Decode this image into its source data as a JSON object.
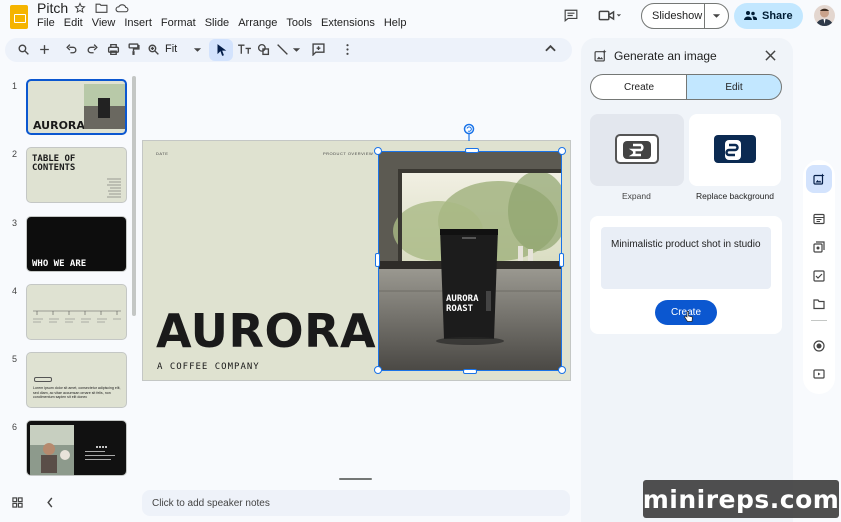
{
  "app": {
    "title": "Pitch"
  },
  "menu": [
    "File",
    "Edit",
    "View",
    "Insert",
    "Format",
    "Slide",
    "Arrange",
    "Tools",
    "Extensions",
    "Help"
  ],
  "header": {
    "slideshow_label": "Slideshow",
    "share_label": "Share"
  },
  "toolbar": {
    "zoom": "Fit"
  },
  "slides": [
    {
      "num": "1",
      "title": "AURORA"
    },
    {
      "num": "2",
      "title": "TABLE OF CONTENTS"
    },
    {
      "num": "3",
      "title": "WHO WE ARE"
    },
    {
      "num": "4",
      "title": ""
    },
    {
      "num": "5",
      "title": "Lorem ipsum dolor sit amet, consectetur adipiscing elit, sed diam, ac vitae accumsan ornare sit felis, non condimentum sapien sit elit donec"
    },
    {
      "num": "6",
      "title": ""
    }
  ],
  "canvas": {
    "title": "AURORA",
    "subtitle": "A COFFEE COMPANY",
    "corner_left": "DATE",
    "corner_right": "PRODUCT OVERVIEW",
    "bag_line1": "AURORA",
    "bag_line2": "ROAST"
  },
  "notes": {
    "placeholder": "Click to add speaker notes"
  },
  "panel": {
    "title": "Generate an image",
    "tab_create": "Create",
    "tab_edit": "Edit",
    "option_expand": "Expand",
    "option_replace": "Replace background",
    "prompt": "Minimalistic product shot in studio",
    "create_button": "Create"
  },
  "watermark": "minireps.com",
  "colors": {
    "accent": "#0b57d0",
    "share_bg": "#c2e7ff",
    "slide_bg": "#dfe2d0"
  }
}
